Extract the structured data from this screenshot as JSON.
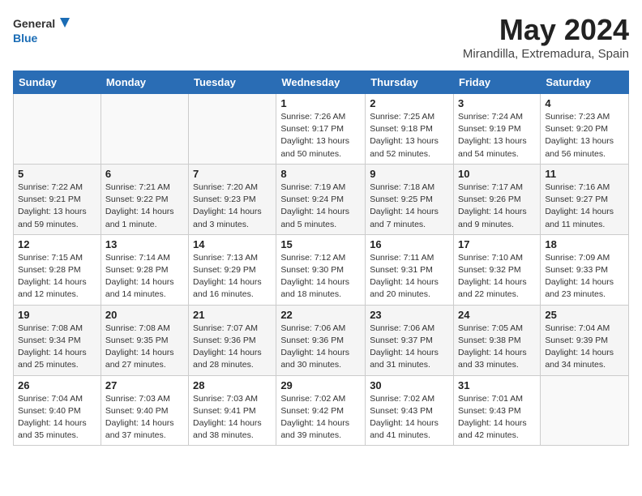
{
  "logo": {
    "line1": "General",
    "line2": "Blue"
  },
  "title": "May 2024",
  "subtitle": "Mirandilla, Extremadura, Spain",
  "days_of_week": [
    "Sunday",
    "Monday",
    "Tuesday",
    "Wednesday",
    "Thursday",
    "Friday",
    "Saturday"
  ],
  "weeks": [
    [
      {
        "day": "",
        "info": ""
      },
      {
        "day": "",
        "info": ""
      },
      {
        "day": "",
        "info": ""
      },
      {
        "day": "1",
        "info": "Sunrise: 7:26 AM\nSunset: 9:17 PM\nDaylight: 13 hours\nand 50 minutes."
      },
      {
        "day": "2",
        "info": "Sunrise: 7:25 AM\nSunset: 9:18 PM\nDaylight: 13 hours\nand 52 minutes."
      },
      {
        "day": "3",
        "info": "Sunrise: 7:24 AM\nSunset: 9:19 PM\nDaylight: 13 hours\nand 54 minutes."
      },
      {
        "day": "4",
        "info": "Sunrise: 7:23 AM\nSunset: 9:20 PM\nDaylight: 13 hours\nand 56 minutes."
      }
    ],
    [
      {
        "day": "5",
        "info": "Sunrise: 7:22 AM\nSunset: 9:21 PM\nDaylight: 13 hours\nand 59 minutes."
      },
      {
        "day": "6",
        "info": "Sunrise: 7:21 AM\nSunset: 9:22 PM\nDaylight: 14 hours\nand 1 minute."
      },
      {
        "day": "7",
        "info": "Sunrise: 7:20 AM\nSunset: 9:23 PM\nDaylight: 14 hours\nand 3 minutes."
      },
      {
        "day": "8",
        "info": "Sunrise: 7:19 AM\nSunset: 9:24 PM\nDaylight: 14 hours\nand 5 minutes."
      },
      {
        "day": "9",
        "info": "Sunrise: 7:18 AM\nSunset: 9:25 PM\nDaylight: 14 hours\nand 7 minutes."
      },
      {
        "day": "10",
        "info": "Sunrise: 7:17 AM\nSunset: 9:26 PM\nDaylight: 14 hours\nand 9 minutes."
      },
      {
        "day": "11",
        "info": "Sunrise: 7:16 AM\nSunset: 9:27 PM\nDaylight: 14 hours\nand 11 minutes."
      }
    ],
    [
      {
        "day": "12",
        "info": "Sunrise: 7:15 AM\nSunset: 9:28 PM\nDaylight: 14 hours\nand 12 minutes."
      },
      {
        "day": "13",
        "info": "Sunrise: 7:14 AM\nSunset: 9:28 PM\nDaylight: 14 hours\nand 14 minutes."
      },
      {
        "day": "14",
        "info": "Sunrise: 7:13 AM\nSunset: 9:29 PM\nDaylight: 14 hours\nand 16 minutes."
      },
      {
        "day": "15",
        "info": "Sunrise: 7:12 AM\nSunset: 9:30 PM\nDaylight: 14 hours\nand 18 minutes."
      },
      {
        "day": "16",
        "info": "Sunrise: 7:11 AM\nSunset: 9:31 PM\nDaylight: 14 hours\nand 20 minutes."
      },
      {
        "day": "17",
        "info": "Sunrise: 7:10 AM\nSunset: 9:32 PM\nDaylight: 14 hours\nand 22 minutes."
      },
      {
        "day": "18",
        "info": "Sunrise: 7:09 AM\nSunset: 9:33 PM\nDaylight: 14 hours\nand 23 minutes."
      }
    ],
    [
      {
        "day": "19",
        "info": "Sunrise: 7:08 AM\nSunset: 9:34 PM\nDaylight: 14 hours\nand 25 minutes."
      },
      {
        "day": "20",
        "info": "Sunrise: 7:08 AM\nSunset: 9:35 PM\nDaylight: 14 hours\nand 27 minutes."
      },
      {
        "day": "21",
        "info": "Sunrise: 7:07 AM\nSunset: 9:36 PM\nDaylight: 14 hours\nand 28 minutes."
      },
      {
        "day": "22",
        "info": "Sunrise: 7:06 AM\nSunset: 9:36 PM\nDaylight: 14 hours\nand 30 minutes."
      },
      {
        "day": "23",
        "info": "Sunrise: 7:06 AM\nSunset: 9:37 PM\nDaylight: 14 hours\nand 31 minutes."
      },
      {
        "day": "24",
        "info": "Sunrise: 7:05 AM\nSunset: 9:38 PM\nDaylight: 14 hours\nand 33 minutes."
      },
      {
        "day": "25",
        "info": "Sunrise: 7:04 AM\nSunset: 9:39 PM\nDaylight: 14 hours\nand 34 minutes."
      }
    ],
    [
      {
        "day": "26",
        "info": "Sunrise: 7:04 AM\nSunset: 9:40 PM\nDaylight: 14 hours\nand 35 minutes."
      },
      {
        "day": "27",
        "info": "Sunrise: 7:03 AM\nSunset: 9:40 PM\nDaylight: 14 hours\nand 37 minutes."
      },
      {
        "day": "28",
        "info": "Sunrise: 7:03 AM\nSunset: 9:41 PM\nDaylight: 14 hours\nand 38 minutes."
      },
      {
        "day": "29",
        "info": "Sunrise: 7:02 AM\nSunset: 9:42 PM\nDaylight: 14 hours\nand 39 minutes."
      },
      {
        "day": "30",
        "info": "Sunrise: 7:02 AM\nSunset: 9:43 PM\nDaylight: 14 hours\nand 41 minutes."
      },
      {
        "day": "31",
        "info": "Sunrise: 7:01 AM\nSunset: 9:43 PM\nDaylight: 14 hours\nand 42 minutes."
      },
      {
        "day": "",
        "info": ""
      }
    ]
  ]
}
